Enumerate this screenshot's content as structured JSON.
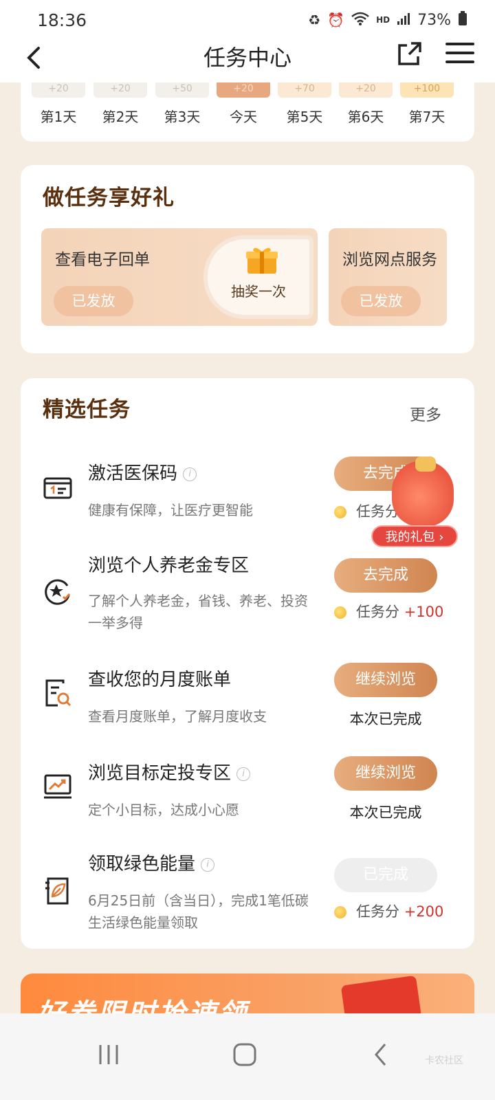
{
  "status": {
    "time": "18:36",
    "hd": "HD",
    "battery": "73%"
  },
  "header": {
    "title": "任务中心"
  },
  "checkin": {
    "rewards": [
      "+20",
      "+20",
      "+50",
      "+20",
      "+70",
      "+20",
      "+100"
    ],
    "days": [
      "第1天",
      "第2天",
      "第3天",
      "今天",
      "第5天",
      "第6天",
      "第7天"
    ]
  },
  "gift_section": {
    "title": "做任务享好礼",
    "items": [
      {
        "name": "查看电子回单",
        "status": "已发放",
        "prize": "抽奖一次"
      },
      {
        "name": "浏览网点服务",
        "status": "已发放"
      }
    ]
  },
  "featured": {
    "title": "精选任务",
    "more": "更多",
    "tasks": [
      {
        "name": "激活医保码",
        "desc": "健康有保障，让医疗更智能",
        "button": "去完成",
        "reward_label": "任务分",
        "reward_points": ""
      },
      {
        "name": "浏览个人养老金专区",
        "desc": "了解个人养老金，省钱、养老、投资一举多得",
        "button": "去完成",
        "reward_label": "任务分",
        "reward_points": "+100"
      },
      {
        "name": "查收您的月度账单",
        "desc": "查看月度账单，了解月度收支",
        "button": "继续浏览",
        "status": "本次已完成"
      },
      {
        "name": "浏览目标定投专区",
        "desc": "定个小目标，达成小心愿",
        "button": "继续浏览",
        "status": "本次已完成"
      },
      {
        "name": "领取绿色能量",
        "desc": "6月25日前（含当日），完成1笔低碳生活绿色能量领取",
        "button": "已完成",
        "reward_label": "任务分",
        "reward_points": "+200"
      }
    ]
  },
  "floating": {
    "my_gift": "我的礼包 ›"
  },
  "banner": {
    "text": "好券限时抢速领"
  },
  "watermark": "卡农社区",
  "colors": {
    "accent": "#d08550",
    "points": "#d0322b",
    "background": "#f5ece2"
  }
}
